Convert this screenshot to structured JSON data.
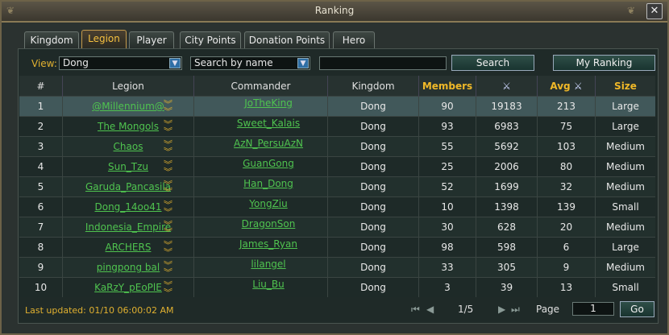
{
  "window": {
    "title": "Ranking"
  },
  "tabs": [
    {
      "label": "Kingdom",
      "active": false
    },
    {
      "label": "Legion",
      "active": true
    },
    {
      "label": "Player",
      "active": false
    },
    {
      "label": "City Points",
      "active": false
    },
    {
      "label": "Donation Points",
      "active": false
    },
    {
      "label": "Hero",
      "active": false
    }
  ],
  "filters": {
    "view_label": "View:",
    "view_value": "Dong",
    "search_mode": "Search by name",
    "search_value": "",
    "search_button": "Search",
    "my_ranking_button": "My Ranking"
  },
  "table": {
    "headers": {
      "rank": "#",
      "legion": "Legion",
      "commander": "Commander",
      "kingdom": "Kingdom",
      "members": "Members",
      "power_icon": "sword-icon",
      "avg": "Avg",
      "avg_icon": "sword-icon",
      "size": "Size"
    },
    "rows": [
      {
        "rank": "1",
        "legion": "@Millennium@",
        "commander": "JoTheKing",
        "kingdom": "Dong",
        "members": "90",
        "power": "19183",
        "avg": "213",
        "size": "Large"
      },
      {
        "rank": "2",
        "legion": "The Mongols",
        "commander": "Sweet_Kalais",
        "kingdom": "Dong",
        "members": "93",
        "power": "6983",
        "avg": "75",
        "size": "Large"
      },
      {
        "rank": "3",
        "legion": "Chaos",
        "commander": "AzN_PersuAzN",
        "kingdom": "Dong",
        "members": "55",
        "power": "5692",
        "avg": "103",
        "size": "Medium"
      },
      {
        "rank": "4",
        "legion": "Sun_Tzu",
        "commander": "GuanGong",
        "kingdom": "Dong",
        "members": "25",
        "power": "2006",
        "avg": "80",
        "size": "Medium"
      },
      {
        "rank": "5",
        "legion": "Garuda_Pancasila",
        "commander": "Han_Dong",
        "kingdom": "Dong",
        "members": "52",
        "power": "1699",
        "avg": "32",
        "size": "Medium"
      },
      {
        "rank": "6",
        "legion": "Dong_14oo41",
        "commander": "YongZiu",
        "kingdom": "Dong",
        "members": "10",
        "power": "1398",
        "avg": "139",
        "size": "Small"
      },
      {
        "rank": "7",
        "legion": "Indonesia_Empire",
        "commander": "DragonSon",
        "kingdom": "Dong",
        "members": "30",
        "power": "628",
        "avg": "20",
        "size": "Medium"
      },
      {
        "rank": "8",
        "legion": "ARCHERS",
        "commander": "James_Ryan",
        "kingdom": "Dong",
        "members": "98",
        "power": "598",
        "avg": "6",
        "size": "Large"
      },
      {
        "rank": "9",
        "legion": "pingpong bal",
        "commander": "lilangel",
        "kingdom": "Dong",
        "members": "33",
        "power": "305",
        "avg": "9",
        "size": "Medium"
      },
      {
        "rank": "10",
        "legion": "KaRzY_pEoPlE",
        "commander": "Liu_Bu",
        "kingdom": "Dong",
        "members": "3",
        "power": "39",
        "avg": "13",
        "size": "Small"
      }
    ]
  },
  "footer": {
    "last_updated": "Last updated: 01/10 06:00:02 AM",
    "page_indicator": "1/5",
    "page_label": "Page",
    "page_value": "1",
    "go_button": "Go"
  }
}
